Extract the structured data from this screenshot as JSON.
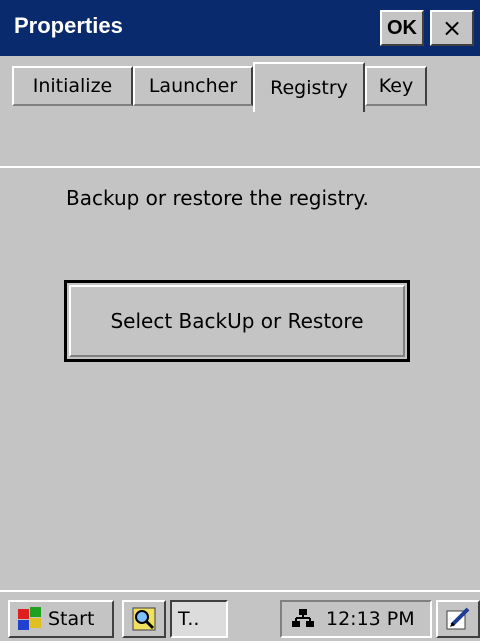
{
  "window": {
    "title": "Properties",
    "ok_label": "OK",
    "close_label": "×"
  },
  "tabs": [
    {
      "label": "Initialize",
      "active": false
    },
    {
      "label": "Launcher",
      "active": false
    },
    {
      "label": "Registry",
      "active": true
    },
    {
      "label": "Key",
      "active": false
    }
  ],
  "content": {
    "message": "Backup or restore the registry.",
    "button_label": "Select BackUp or Restore"
  },
  "taskbar": {
    "start_label": "Start",
    "task_label": "T..",
    "clock": "12:13 PM",
    "icons": [
      "windows-flag-icon",
      "magnifier-icon",
      "network-icon",
      "pen-icon"
    ]
  },
  "colors": {
    "titlebar": "#0a2a6e",
    "face": "#c4c4c4"
  }
}
